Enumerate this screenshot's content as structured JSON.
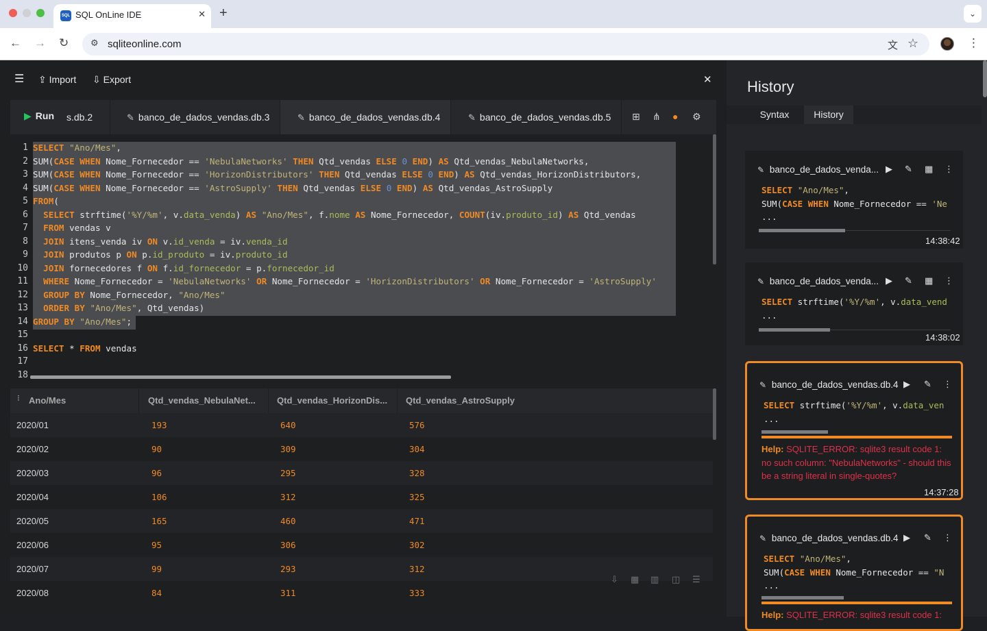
{
  "browser": {
    "tab_title": "SQL OnLine IDE",
    "tab_icon_text": "SQL",
    "url": "sqliteonline.com",
    "icons": [
      "close-icon",
      "plus-icon",
      "chevron-down-icon",
      "back-icon",
      "forward-icon",
      "reload-icon",
      "tune-icon",
      "translate-icon",
      "star-icon",
      "kebab-icon"
    ]
  },
  "toolbar": {
    "import_label": "Import",
    "export_label": "Export"
  },
  "tabs": {
    "run_label": "Run",
    "items": [
      {
        "label": "s.db.2"
      },
      {
        "label": "banco_de_dados_vendas.db.3"
      },
      {
        "label": "banco_de_dados_vendas.db.4"
      },
      {
        "label": "banco_de_dados_vendas.db.5"
      }
    ],
    "active_index": 2
  },
  "editor": {
    "line_numbers": [
      "1",
      "2",
      "3",
      "4",
      "5",
      "6",
      "7",
      "8",
      "9",
      "10",
      "11",
      "12",
      "13",
      "14",
      "15",
      "16",
      "17",
      "18"
    ]
  },
  "results": {
    "columns": [
      "Ano/Mes",
      "Qtd_vendas_NebulaNet...",
      "Qtd_vendas_HorizonDis...",
      "Qtd_vendas_AstroSupply"
    ],
    "rows": [
      [
        "2020/01",
        "193",
        "640",
        "576"
      ],
      [
        "2020/02",
        "90",
        "309",
        "304"
      ],
      [
        "2020/03",
        "96",
        "295",
        "328"
      ],
      [
        "2020/04",
        "106",
        "312",
        "325"
      ],
      [
        "2020/05",
        "165",
        "460",
        "471"
      ],
      [
        "2020/06",
        "95",
        "306",
        "302"
      ],
      [
        "2020/07",
        "99",
        "293",
        "312"
      ],
      [
        "2020/08",
        "84",
        "311",
        "333"
      ]
    ]
  },
  "history": {
    "title": "History",
    "tabs": [
      "Syntax",
      "History"
    ],
    "active_tab": "History",
    "cards": [
      {
        "db": "banco_de_dados_venda...",
        "time": "14:38:42",
        "error": false,
        "progress": 0.45
      },
      {
        "db": "banco_de_dados_venda...",
        "time": "14:38:02",
        "error": false,
        "progress": 0.37
      },
      {
        "db": "banco_de_dados_vendas.db.4",
        "time": "14:37:28",
        "error": true,
        "progress": 0.35,
        "help_label": "Help:",
        "help_text": "SQLITE_ERROR: sqlite3 result code 1: no such column: \"NebulaNetworks\" - should this be a string literal in single-quotes?"
      },
      {
        "db": "banco_de_dados_vendas.db.4",
        "time": "",
        "error": true,
        "progress": 0.43,
        "help_label": "Help:",
        "help_text": "SQLITE_ERROR: sqlite3 result code 1:"
      }
    ],
    "ellipsis": "..."
  }
}
